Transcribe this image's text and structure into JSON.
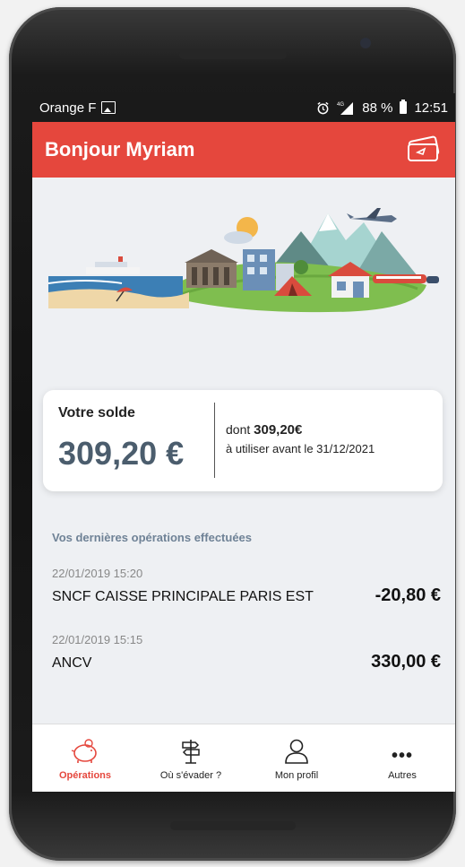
{
  "status_bar": {
    "carrier": "Orange F",
    "battery_text": "88 %",
    "time": "12:51",
    "icons": [
      "image-icon",
      "alarm-icon",
      "signal-4g-icon",
      "battery-icon"
    ]
  },
  "header": {
    "title": "Bonjour Myriam",
    "icon": "tickets-icon",
    "color": "#e5473d"
  },
  "balance": {
    "label": "Votre solde",
    "amount": "309,20 €",
    "dont_prefix": "dont",
    "dont_amount": "309,20€",
    "expiry": "à utiliser avant le 31/12/2021"
  },
  "operations": {
    "title": "Vos dernières opérations effectuées",
    "items": [
      {
        "date": "22/01/2019 15:20",
        "name": "SNCF CAISSE PRINCIPALE PARIS EST",
        "amount": "-20,80 €"
      },
      {
        "date": "22/01/2019 15:15",
        "name": "ANCV",
        "amount": "330,00 €"
      }
    ]
  },
  "nav": {
    "items": [
      {
        "label": "Opérations",
        "icon": "piggy-bank-icon",
        "active": true
      },
      {
        "label": "Où s'évader ?",
        "icon": "signpost-icon",
        "active": false
      },
      {
        "label": "Mon profil",
        "icon": "user-icon",
        "active": false
      },
      {
        "label": "Autres",
        "icon": "more-icon",
        "active": false
      }
    ]
  }
}
